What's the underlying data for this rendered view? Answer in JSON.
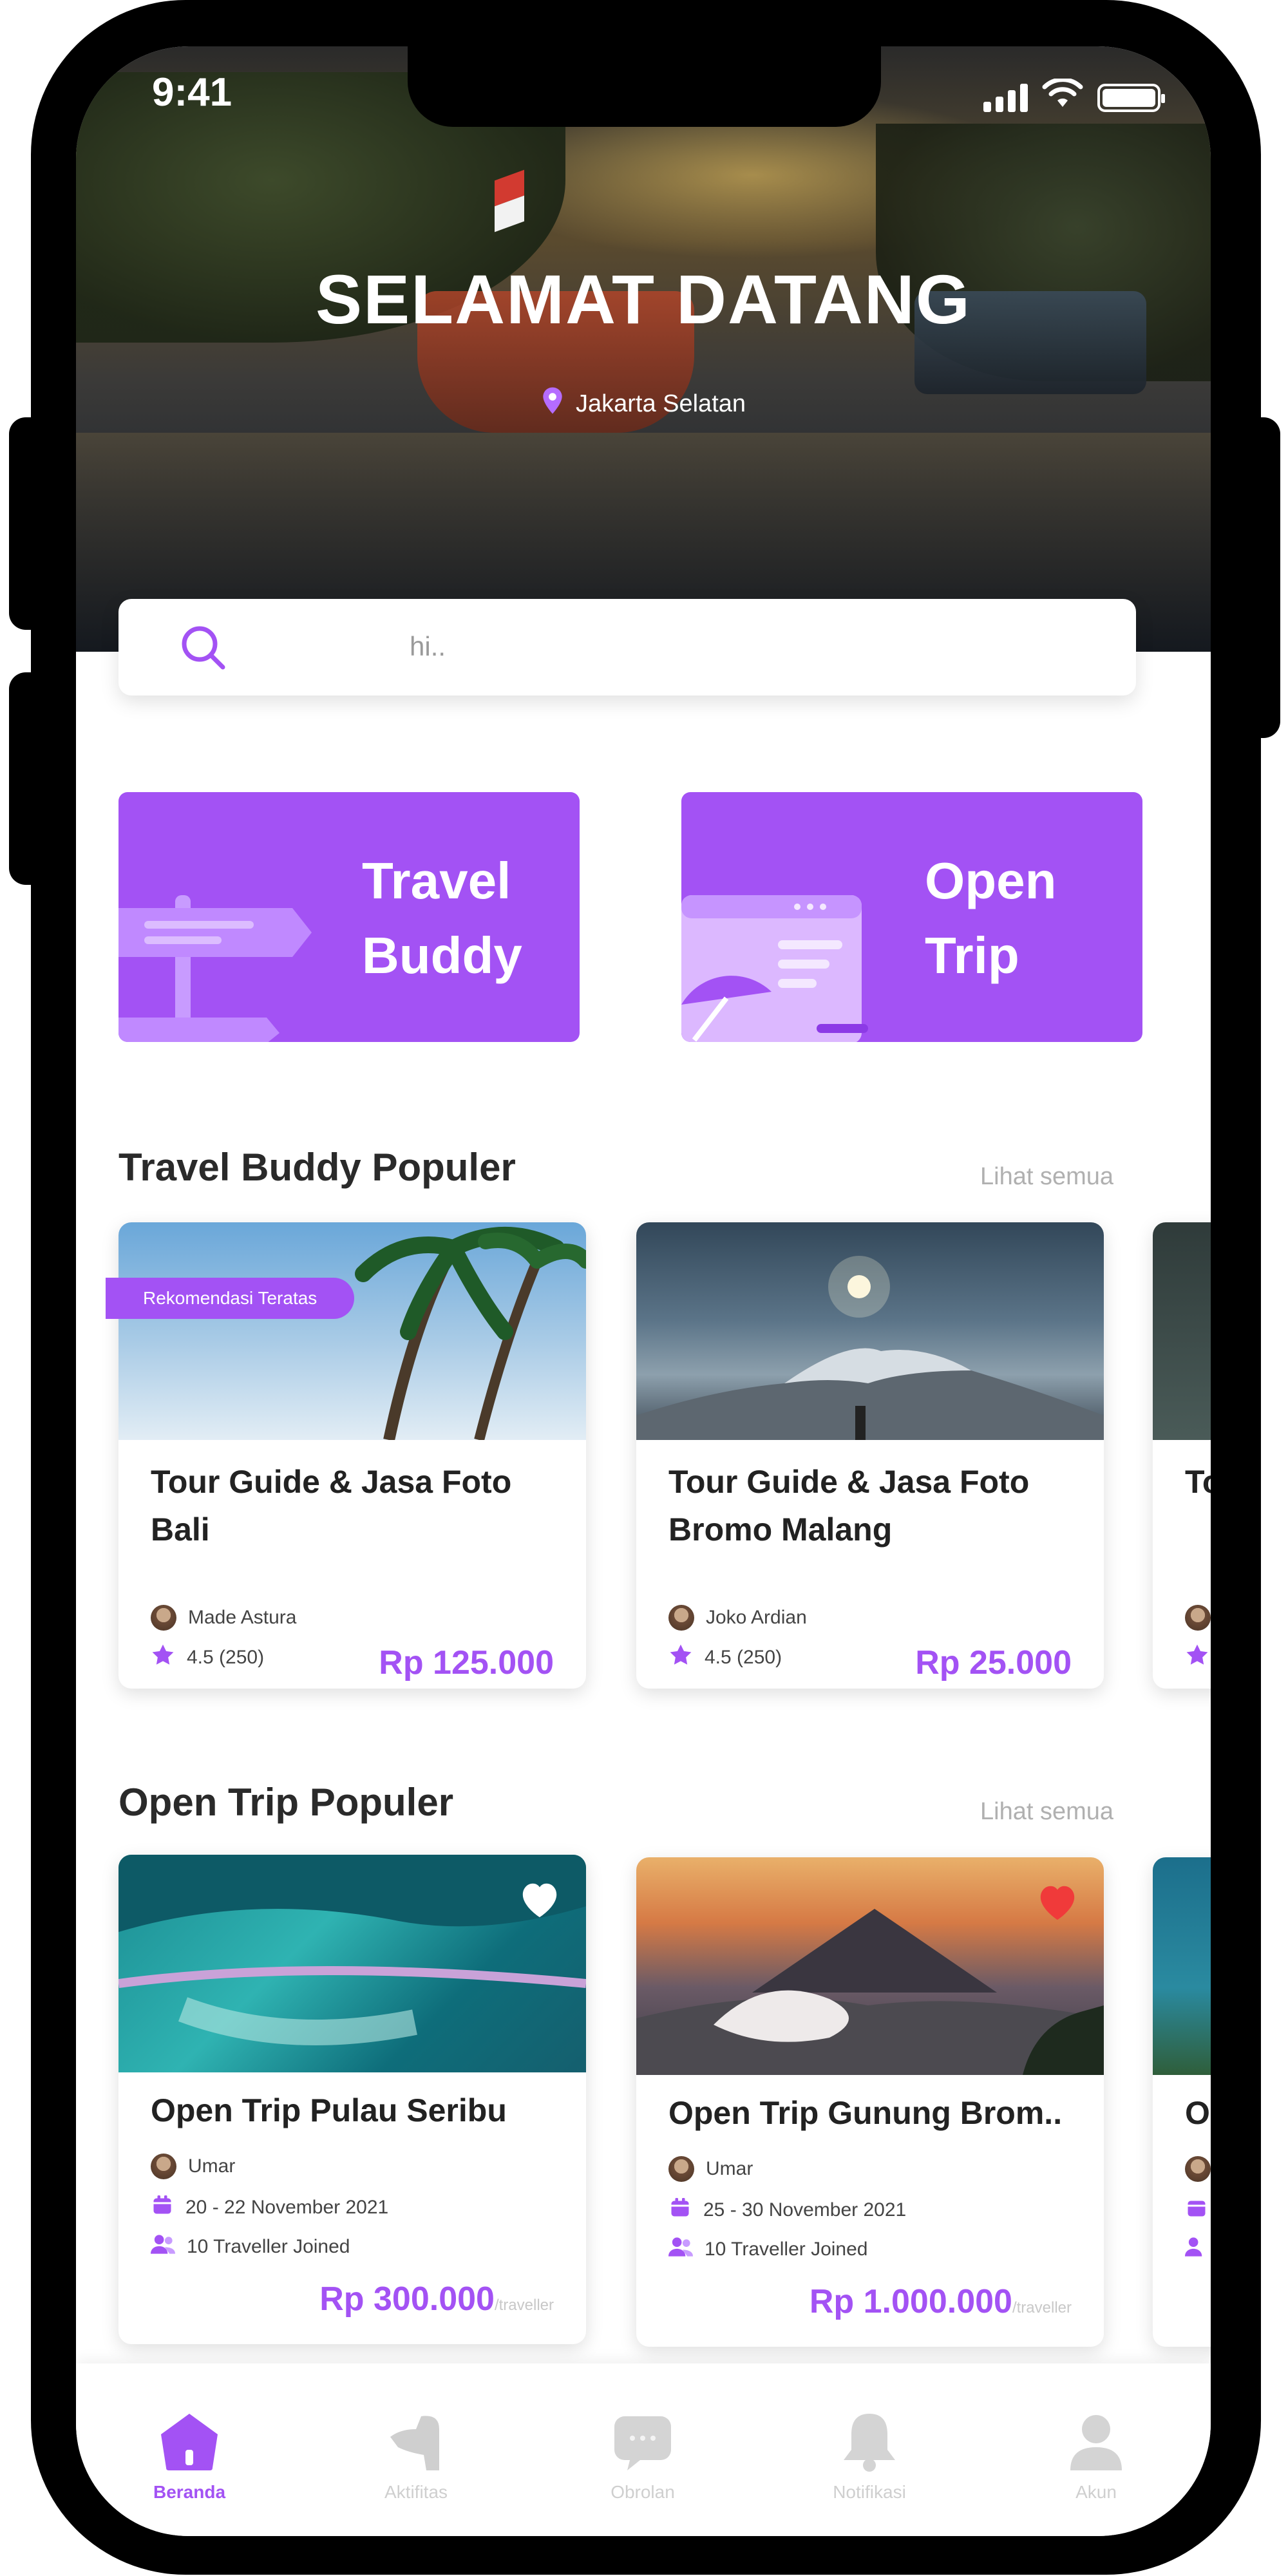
{
  "status_bar": {
    "time": "9:41"
  },
  "hero": {
    "title": "SELAMAT DATANG",
    "location": "Jakarta Selatan"
  },
  "search": {
    "placeholder": "hi.."
  },
  "categories": [
    {
      "line1": "Travel",
      "line2": "Buddy"
    },
    {
      "line1": "Open",
      "line2": "Trip"
    }
  ],
  "travel_buddy_section": {
    "title": "Travel Buddy Populer",
    "see_all": "Lihat semua",
    "badge": "Rekomendasi Teratas",
    "cards": [
      {
        "title_line1": "Tour Guide & Jasa Foto",
        "title_line2": "Bali",
        "guide": "Made Astura",
        "rating": "4.5 (250)",
        "price": "Rp 125.000"
      },
      {
        "title_line1": "Tour Guide & Jasa Foto",
        "title_line2": "Bromo Malang",
        "guide": "Joko Ardian",
        "rating": "4.5 (250)",
        "price": "Rp 25.000"
      },
      {
        "title_line1": "To"
      }
    ]
  },
  "open_trip_section": {
    "title": "Open Trip Populer",
    "see_all": "Lihat semua",
    "cards": [
      {
        "title": "Open Trip Pulau Seribu",
        "host": "Umar",
        "dates": "20 - 22 November 2021",
        "joined": "10 Traveller Joined",
        "price": "Rp 300.000",
        "unit": "/traveller",
        "favorited": false
      },
      {
        "title": "Open Trip Gunung Brom..",
        "host": "Umar",
        "dates": "25 - 30 November 2021",
        "joined": "10 Traveller Joined",
        "price": "Rp 1.000.000",
        "unit": "/traveller",
        "favorited": true
      },
      {
        "title": "O"
      }
    ]
  },
  "bottom_nav": [
    {
      "label": "Beranda",
      "icon": "home-icon",
      "active": true
    },
    {
      "label": "Aktifitas",
      "icon": "activity-icon",
      "active": false
    },
    {
      "label": "Obrolan",
      "icon": "chat-icon",
      "active": false
    },
    {
      "label": "Notifikasi",
      "icon": "bell-icon",
      "active": false
    },
    {
      "label": "Akun",
      "icon": "user-icon",
      "active": false
    }
  ],
  "colors": {
    "accent": "#a352f4",
    "favorite": "#f03a3a",
    "text": "#2a2a2a",
    "muted": "#b0b0b0"
  }
}
